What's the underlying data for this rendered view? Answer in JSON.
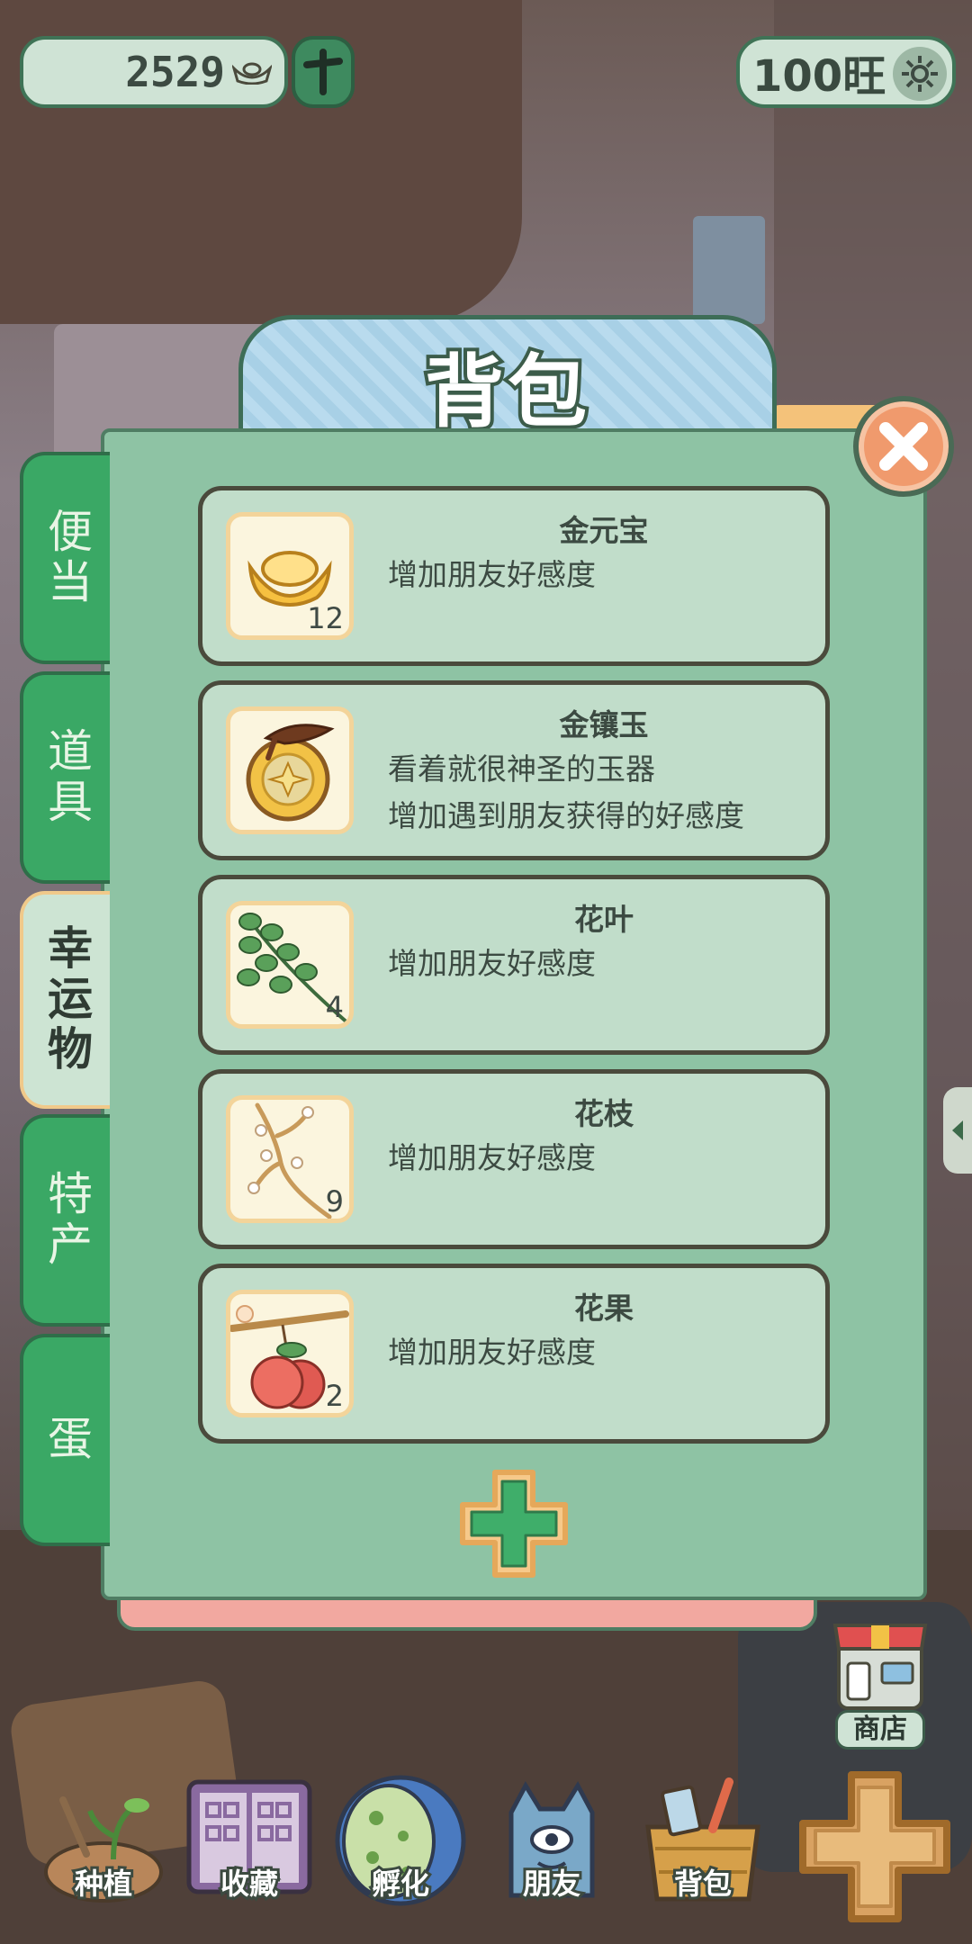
{
  "hud": {
    "currency_amount": "2529",
    "level_label": "100旺"
  },
  "panel": {
    "title": "背包"
  },
  "categories": [
    {
      "label": "便当",
      "active": false
    },
    {
      "label": "道具",
      "active": false
    },
    {
      "label": "幸运物",
      "active": true
    },
    {
      "label": "特产",
      "active": false
    },
    {
      "label": "蛋",
      "active": false
    }
  ],
  "items": [
    {
      "name": "金元宝",
      "desc": [
        "增加朋友好感度"
      ],
      "count": "12",
      "icon": "gold-ingot-icon"
    },
    {
      "name": "金镶玉",
      "desc": [
        "看着就很神圣的玉器",
        "增加遇到朋友获得的好感度"
      ],
      "count": "",
      "icon": "gold-jade-icon"
    },
    {
      "name": "花叶",
      "desc": [
        "增加朋友好感度"
      ],
      "count": "4",
      "icon": "flower-leaf-icon"
    },
    {
      "name": "花枝",
      "desc": [
        "增加朋友好感度"
      ],
      "count": "9",
      "icon": "flower-branch-icon"
    },
    {
      "name": "花果",
      "desc": [
        "增加朋友好感度"
      ],
      "count": "2",
      "icon": "flower-fruit-icon"
    }
  ],
  "shop": {
    "label": "商店"
  },
  "nav": [
    {
      "label": "种植",
      "icon": "plant-icon"
    },
    {
      "label": "收藏",
      "icon": "collection-book-icon"
    },
    {
      "label": "孵化",
      "icon": "egg-icon"
    },
    {
      "label": "朋友",
      "icon": "cat-friend-icon"
    },
    {
      "label": "背包",
      "icon": "backpack-basket-icon"
    }
  ],
  "colors": {
    "panel_green": "#8ec3a4",
    "card_bg": "#c1ddca",
    "tab_green": "#3aa865",
    "close_orange": "#f09a6d",
    "title_blue": "#a8d0e6"
  }
}
